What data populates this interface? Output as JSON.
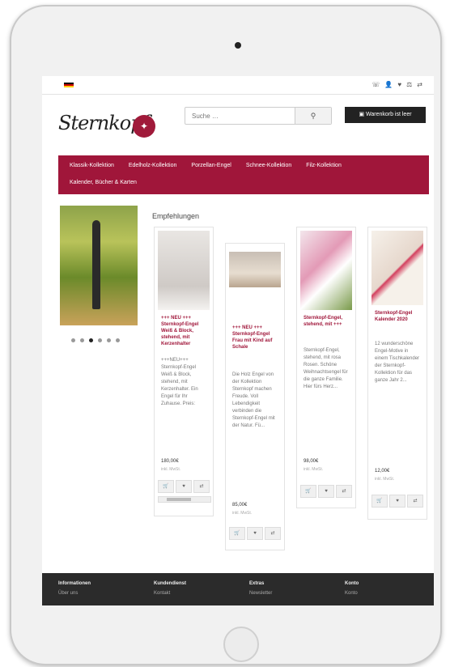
{
  "top_icons": [
    "☏",
    "👤",
    "♥",
    "⚖",
    "⇄"
  ],
  "logo": {
    "text": "Sternkopf"
  },
  "search": {
    "placeholder": "Suche …",
    "icon": "search-icon"
  },
  "cart": {
    "label": "Warenkorb ist leer"
  },
  "nav": {
    "row1": [
      "Klassik-Kollektion",
      "Edelholz-Kollektion",
      "Porzellan-Engel",
      "Schnee-Kollektion",
      "Filz-Kollektion"
    ],
    "row2": [
      "Kalender, Bücher & Karten"
    ]
  },
  "carousel": {
    "dots": 6,
    "active_index": 2
  },
  "section_title": "Empfehlungen",
  "products": [
    {
      "title": "+++ NEU +++ Sternkopf-Engel Weiß & Block, stehend, mit Kerzenhalter",
      "desc": "+++NEU+++ Sternkopf-Engel Weiß & Block, stehend, mit Kerzenhalter. Ein Engel für Ihr Zuhause. Preis:",
      "price": "180,00€",
      "tax": "inkl. MwSt."
    },
    {
      "title": "+++ NEU +++ Sternkopf-Engel Frau mit Kind auf Schale",
      "desc": "Die Holz Engel von der Kollektion Sternkopf machen Freude. Voll Lebendigkeit verbinden die Sternkopf-Engel mit der Natur. Fü...",
      "price": "85,00€",
      "tax": "inkl. MwSt."
    },
    {
      "title": "Sternkopf-Engel, stehend, mit +++",
      "desc": "Sternkopf-Engel, stehend, mit rosa Rosen. Schöne Weihnachtsengel für die ganze Familie. Hier fürs Herz...",
      "price": "98,00€",
      "tax": "inkl. MwSt."
    },
    {
      "title": "Sternkopf-Engel Kalender 2020",
      "desc": "12 wunderschöne Engel-Motive in einem Tischkalender der Sternkopf-Kollektion für das ganze Jahr 2...",
      "price": "12,00€",
      "tax": "inkl. MwSt."
    }
  ],
  "footer": {
    "columns": [
      {
        "heading": "Informationen",
        "link": "Über uns"
      },
      {
        "heading": "Kundendienst",
        "link": "Kontakt"
      },
      {
        "heading": "Extras",
        "link": "Newsletter"
      },
      {
        "heading": "Konto",
        "link": "Konto"
      }
    ]
  },
  "colors": {
    "brand": "#a0163a",
    "dark": "#222222",
    "footer": "#2b2b2b"
  }
}
